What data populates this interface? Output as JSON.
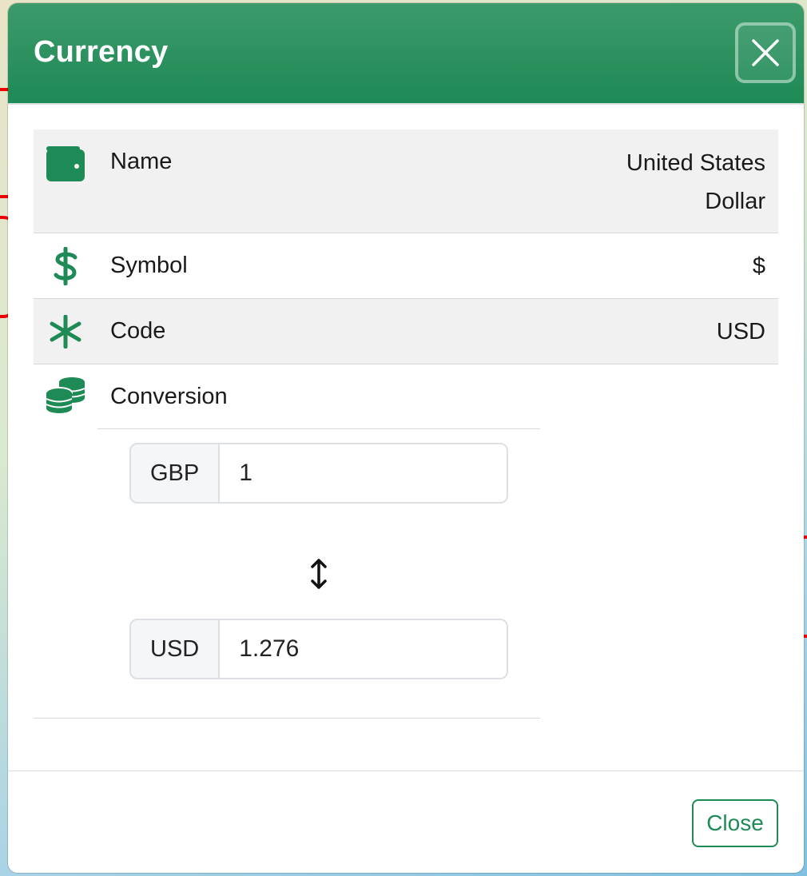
{
  "modal": {
    "title": "Currency",
    "close_footer_label": "Close"
  },
  "details": {
    "name": {
      "label": "Name",
      "value_line1": "United States",
      "value_line2": "Dollar",
      "icon": "wallet-icon"
    },
    "symbol": {
      "label": "Symbol",
      "value": "$",
      "icon": "dollar-sign-icon"
    },
    "code": {
      "label": "Code",
      "value": "USD",
      "icon": "asterisk-icon"
    },
    "conversion": {
      "label": "Conversion",
      "icon": "coins-icon"
    }
  },
  "converter": {
    "from_currency": "GBP",
    "from_value": "1",
    "to_currency": "USD",
    "to_value": "1.276"
  },
  "colors": {
    "brand_green": "#1e8a55",
    "header_gradient_top": "#3d9a6b"
  }
}
